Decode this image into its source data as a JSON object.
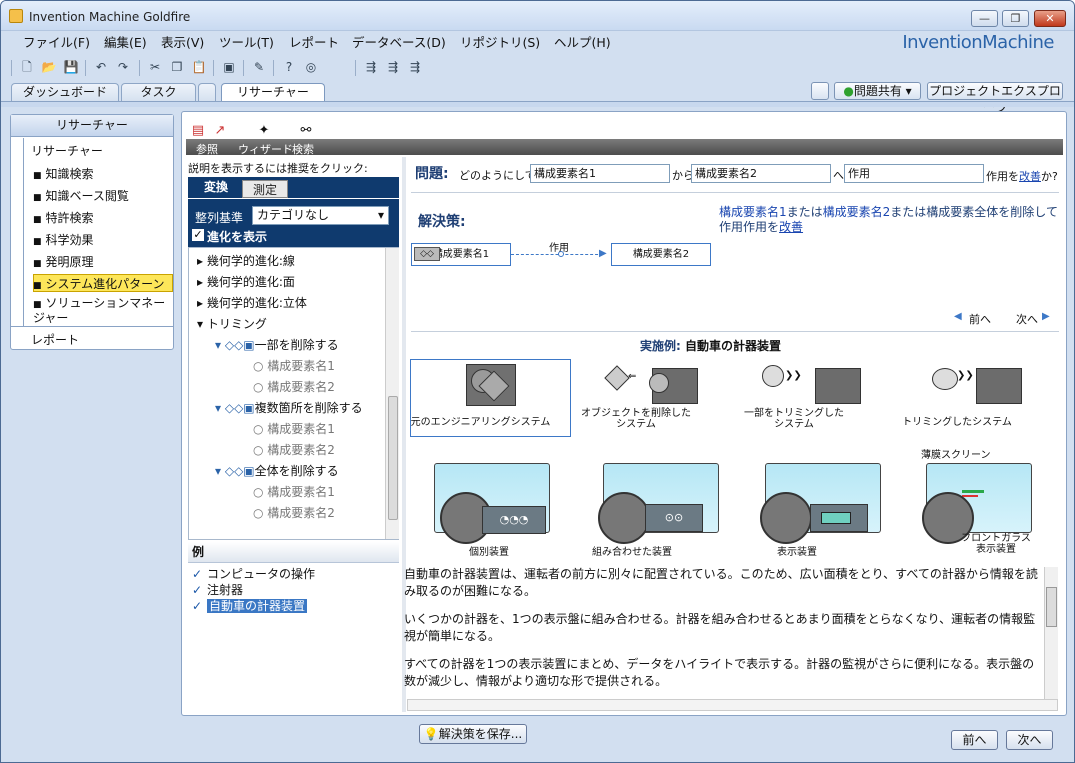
{
  "window": {
    "title": "Invention Machine Goldfire",
    "brand": "InventionMachine"
  },
  "menu": [
    {
      "label": "ファイル(F)"
    },
    {
      "label": "編集(E)"
    },
    {
      "label": "表示(V)"
    },
    {
      "label": "ツール(T)"
    },
    {
      "label": "レポート"
    },
    {
      "label": "データベース(D)"
    },
    {
      "label": "リポジトリ(S)"
    },
    {
      "label": "ヘルプ(H)"
    }
  ],
  "tabs": [
    {
      "label": "ダッシュボード"
    },
    {
      "label": "タスク"
    },
    {
      "label": "リサーチャー"
    }
  ],
  "right_buttons": {
    "share": "問題共有",
    "explorer": "プロジェクトエクスプローラ"
  },
  "sidebar": {
    "header": "リサーチャー",
    "section": "リサーチャー",
    "items": [
      {
        "label": "知識検索"
      },
      {
        "label": "知識ベース閲覧"
      },
      {
        "label": "特許検索"
      },
      {
        "label": "科学効果"
      },
      {
        "label": "発明原理"
      },
      {
        "label": "システム進化パターン"
      },
      {
        "label": "ソリューションマネージャー"
      }
    ],
    "report": "レポート"
  },
  "subtoolbar": {
    "ref": "参照",
    "wizard": "ウィザード",
    "search": "検索"
  },
  "hint": "説明を表示するには推奨をクリック:",
  "transform": {
    "tab_selected": "変換",
    "tab_other": "測定",
    "sort_label": "整列基準",
    "sort_value": "カテゴリなし",
    "show_evolution": "進化を表示"
  },
  "tree": {
    "items": [
      {
        "label": "幾何学的進化:線"
      },
      {
        "label": "幾何学的進化:面"
      },
      {
        "label": "幾何学的進化:立体"
      },
      {
        "label": "トリミング"
      },
      {
        "label": "一部を削除する"
      },
      {
        "label": "構成要素名1"
      },
      {
        "label": "構成要素名2"
      },
      {
        "label": "複数箇所を削除する"
      },
      {
        "label": "構成要素名1"
      },
      {
        "label": "構成要素名2"
      },
      {
        "label": "全体を削除する"
      },
      {
        "label": "構成要素名1"
      },
      {
        "label": "構成要素名2"
      }
    ]
  },
  "examples": {
    "header": "例",
    "items": [
      {
        "label": "コンピュータの操作"
      },
      {
        "label": "注射器"
      },
      {
        "label": "自動車の計器装置"
      }
    ]
  },
  "problem": {
    "label": "問題",
    "text1": "どのようにして",
    "comp1": "構成要素名1",
    "from": "から",
    "comp2": "構成要素名2",
    "to": "へ",
    "action": "作用",
    "suffix": "作用を",
    "improve": "改善",
    "end": "か?"
  },
  "solution": {
    "label": "解決策",
    "text_a": "構成要素名1",
    "text_b": "または",
    "text_c": "構成要素名2",
    "text_d": "または構成要素全体を削除して作用作用を",
    "improve": "改善"
  },
  "diagram": {
    "box1": "構成要素名1",
    "box2": "構成要素名2",
    "link": "作用"
  },
  "nav": {
    "prev": "前へ",
    "next": "次へ"
  },
  "example": {
    "label": "実施例:",
    "name": "自動車の計器装置",
    "steps": [
      {
        "label": "元のエンジニアリングシステム"
      },
      {
        "label": "オブジェクトを削除した\nシステム"
      },
      {
        "label": "一部をトリミングした\nシステム"
      },
      {
        "label": "トリミングしたシステム"
      }
    ],
    "devices": [
      {
        "label": "個別装置"
      },
      {
        "label": "組み合わせた装置"
      },
      {
        "label": "表示装置"
      },
      {
        "label": "フロントガラス\n表示装置"
      }
    ],
    "screen_label": "薄膜スクリーン"
  },
  "description": {
    "p1": "自動車の計器装置は、運転者の前方に別々に配置されている。このため、広い面積をとり、すべての計器から情報を読み取るのが困難になる。",
    "p2": "いくつかの計器を、1つの表示盤に組み合わせる。計器を組み合わせるとあまり面積をとらなくなり、運転者の情報監視が簡単になる。",
    "p3": "すべての計器を1つの表示装置にまとめ、データをハイライトで表示する。計器の監視がさらに便利になる。表示盤の数が減少し、情報がより適切な形で提供される。"
  },
  "bottom": {
    "save": "解決策を保存...",
    "prev": "前へ",
    "next": "次へ"
  }
}
